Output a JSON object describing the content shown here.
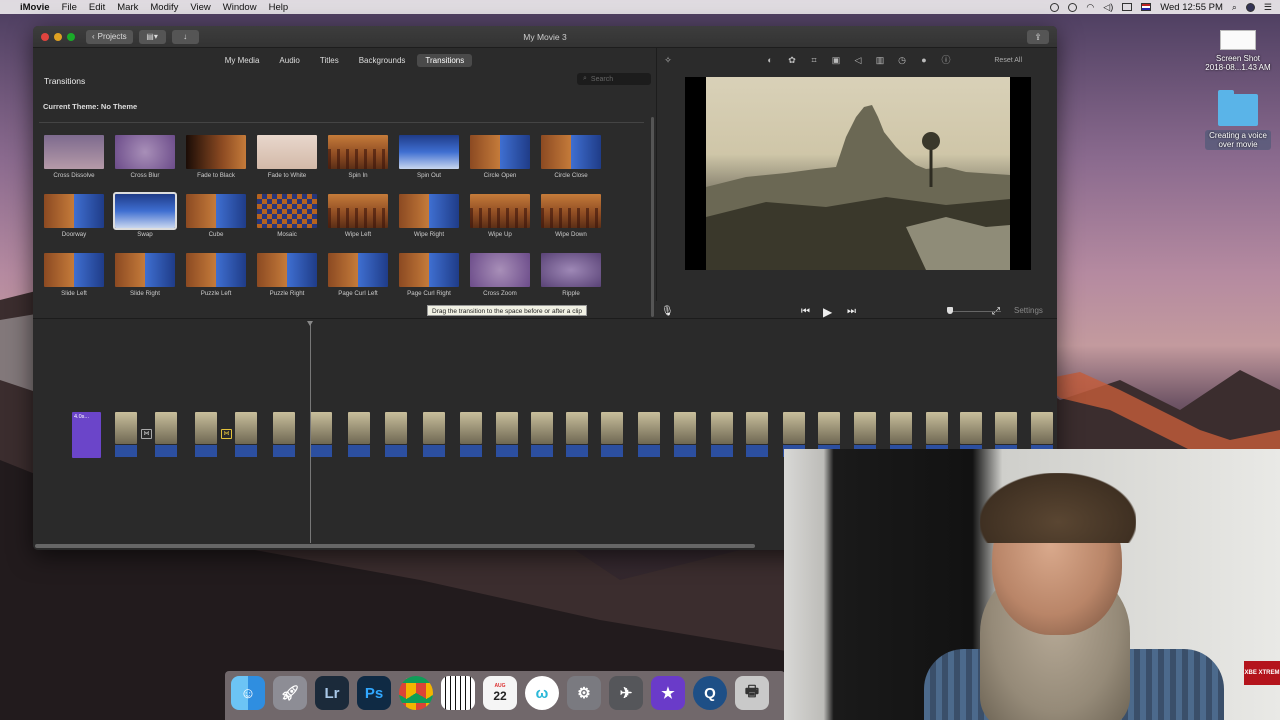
{
  "menubar": {
    "app": "iMovie",
    "items": [
      "File",
      "Edit",
      "Mark",
      "Modify",
      "View",
      "Window",
      "Help"
    ],
    "clock": "Wed 12:55 PM"
  },
  "desktop": {
    "screenshot": {
      "line1": "Screen Shot",
      "line2": "2018-08...1.43 AM"
    },
    "folder": {
      "label": "Creating a voice over movie"
    }
  },
  "window": {
    "title": "My Movie 3",
    "projects_label": "Projects"
  },
  "tabs": [
    {
      "label": "My Media",
      "active": false
    },
    {
      "label": "Audio",
      "active": false
    },
    {
      "label": "Titles",
      "active": false
    },
    {
      "label": "Backgrounds",
      "active": false
    },
    {
      "label": "Transitions",
      "active": true
    }
  ],
  "browser": {
    "heading": "Transitions",
    "search_placeholder": "Search",
    "theme": "Current Theme: No Theme"
  },
  "transitions": [
    {
      "label": "Cross Dissolve",
      "style": "t-fade"
    },
    {
      "label": "Cross Blur",
      "style": "t-zoom"
    },
    {
      "label": "Fade to Black",
      "style": "t-black"
    },
    {
      "label": "Fade to White",
      "style": "t-white"
    },
    {
      "label": "Spin In",
      "style": "t-forest"
    },
    {
      "label": "Spin Out",
      "style": "t-blue"
    },
    {
      "label": "Circle Open",
      "style": "t-split"
    },
    {
      "label": "Circle Close",
      "style": "t-split"
    },
    {
      "label": "Doorway",
      "style": "t-split"
    },
    {
      "label": "Swap",
      "style": "t-blue",
      "selected": true
    },
    {
      "label": "Cube",
      "style": "t-split"
    },
    {
      "label": "Mosaic",
      "style": "t-mosaic"
    },
    {
      "label": "Wipe Left",
      "style": "t-forest"
    },
    {
      "label": "Wipe Right",
      "style": "t-split"
    },
    {
      "label": "Wipe Up",
      "style": "t-forest"
    },
    {
      "label": "Wipe Down",
      "style": "t-forest"
    },
    {
      "label": "Slide Left",
      "style": "t-split"
    },
    {
      "label": "Slide Right",
      "style": "t-split"
    },
    {
      "label": "Puzzle Left",
      "style": "t-split"
    },
    {
      "label": "Puzzle Right",
      "style": "t-split"
    },
    {
      "label": "Page Curl Left",
      "style": "t-split"
    },
    {
      "label": "Page Curl Right",
      "style": "t-split"
    },
    {
      "label": "Cross Zoom",
      "style": "t-zoom"
    },
    {
      "label": "Ripple",
      "style": "t-ripple"
    }
  ],
  "viewer": {
    "reset_label": "Reset All"
  },
  "tooltip": "Drag the transition to the space before or after a clip",
  "timeline": {
    "settings_label": "Settings",
    "title_clip_label": "4.0s..."
  },
  "webcam": {
    "sign_text": "XBE XTREM"
  },
  "dock": {
    "calendar_month": "AUG",
    "calendar_day": "22"
  },
  "colors": {
    "accent_selected": "#4a4a4a",
    "title_clip": "#6b45c9",
    "audio": "#2c4fa0",
    "transition_marker_active": "#e3c23b"
  }
}
